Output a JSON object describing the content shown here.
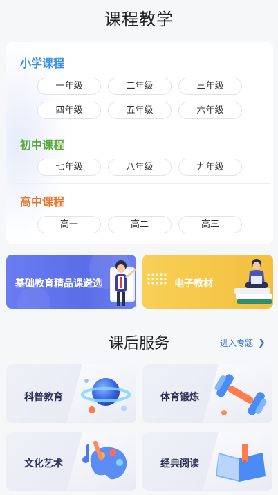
{
  "page_title": "课程教学",
  "stages": {
    "primary": {
      "title": "小学课程",
      "grades": [
        "一年级",
        "二年级",
        "三年级",
        "四年级",
        "五年级",
        "六年级"
      ]
    },
    "junior": {
      "title": "初中课程",
      "grades": [
        "七年级",
        "八年级",
        "九年级"
      ]
    },
    "senior": {
      "title": "高中课程",
      "grades": [
        "高一",
        "高二",
        "高三"
      ]
    }
  },
  "banners": [
    {
      "label": "基础教育精品课遴选",
      "icon": "teacher-illustration"
    },
    {
      "label": "电子教材",
      "icon": "reading-student-illustration"
    }
  ],
  "services": {
    "title": "课后服务",
    "enter_link": "进入专题",
    "items": [
      {
        "label": "科普教育",
        "icon": "planet-icon"
      },
      {
        "label": "体育锻炼",
        "icon": "dumbbell-icon"
      },
      {
        "label": "文化艺术",
        "icon": "palette-icon"
      },
      {
        "label": "经典阅读",
        "icon": "open-book-icon"
      }
    ]
  },
  "colors": {
    "primary_stage": "#3d8fe0",
    "junior_stage": "#5aa83a",
    "senior_stage": "#e4772c",
    "link": "#3b74d9"
  }
}
